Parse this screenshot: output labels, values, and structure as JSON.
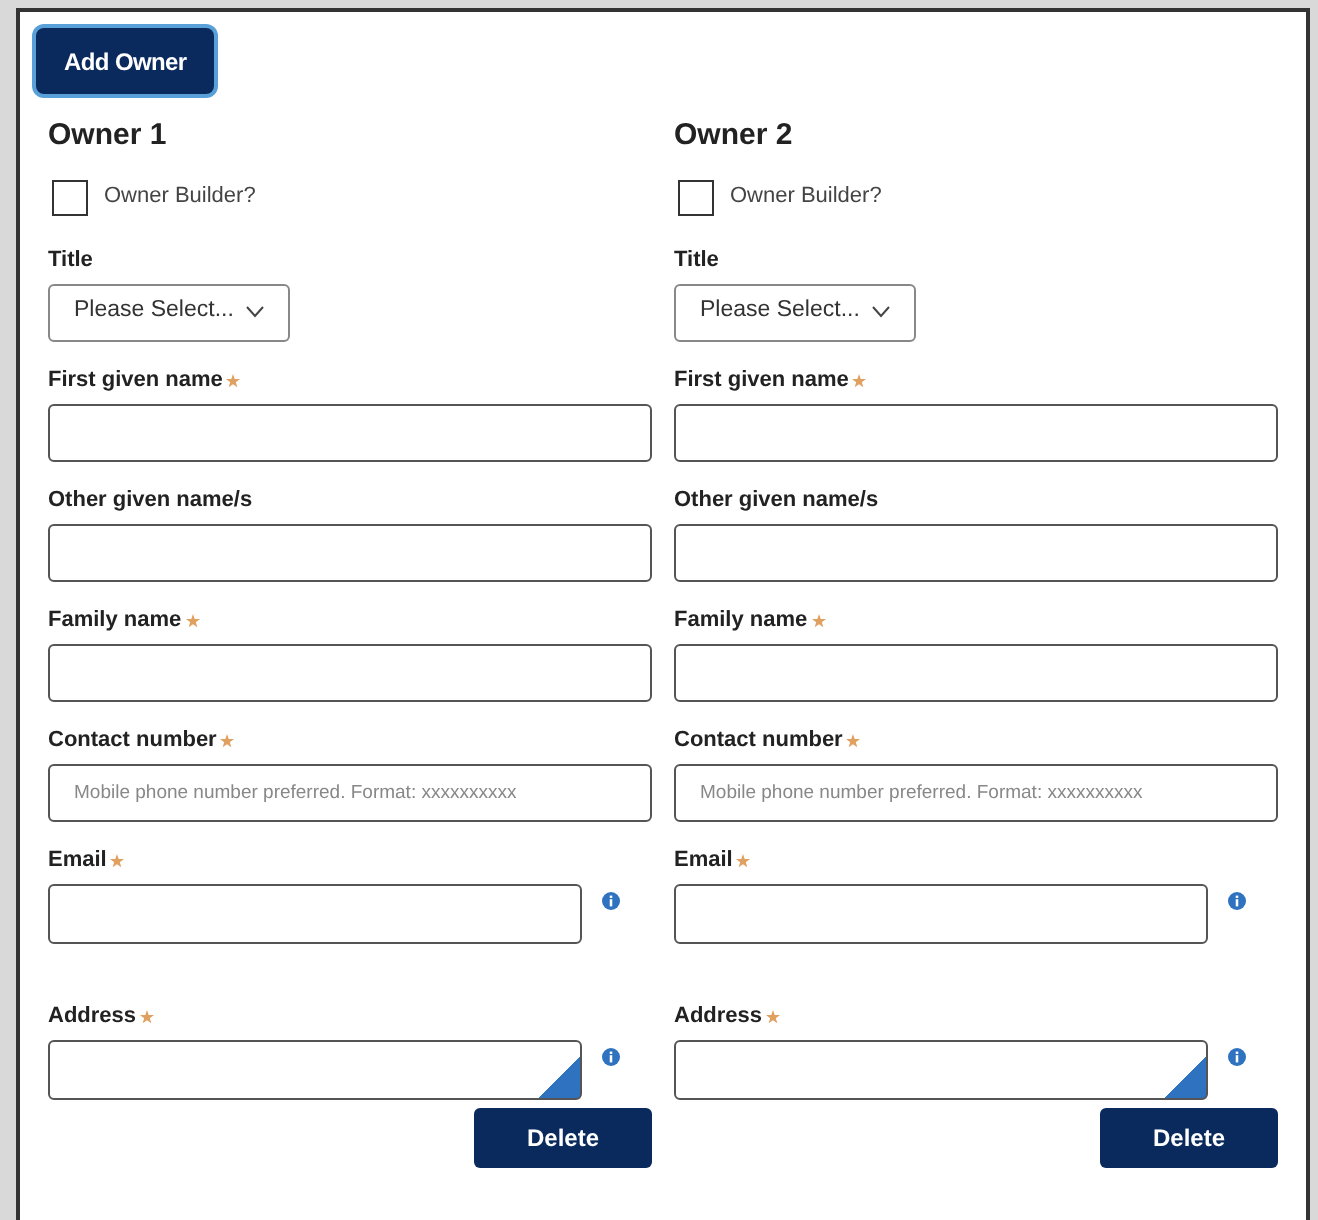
{
  "add_button": "Add Owner",
  "owners": [
    {
      "heading": "Owner 1",
      "owner_builder": {
        "label": "Owner Builder?",
        "checked": false
      },
      "fields": [
        {
          "kind": "select",
          "label": "Title",
          "required": false,
          "value": "Please Select..."
        },
        {
          "kind": "text",
          "label": "First given name",
          "required": true
        },
        {
          "kind": "text",
          "label": "Other given name/s",
          "required": false
        },
        {
          "kind": "text",
          "label": "Family name",
          "required": true
        },
        {
          "kind": "text",
          "label": "Contact number",
          "required": true,
          "placeholder": "Mobile phone number preferred. Format: xxxxxxxxxx"
        },
        {
          "kind": "info-text",
          "label": "Email",
          "required": true
        },
        {
          "kind": "info-textarea",
          "label": "Address",
          "required": true
        }
      ],
      "delete_button": "Delete"
    },
    {
      "heading": "Owner 2",
      "owner_builder": {
        "label": "Owner Builder?",
        "checked": false
      },
      "fields": [
        {
          "kind": "select",
          "label": "Title",
          "required": false,
          "value": "Please Select..."
        },
        {
          "kind": "text",
          "label": "First given name",
          "required": true
        },
        {
          "kind": "text",
          "label": "Other given name/s",
          "required": false
        },
        {
          "kind": "text",
          "label": "Family name",
          "required": true
        },
        {
          "kind": "text",
          "label": "Contact number",
          "required": true,
          "placeholder": "Mobile phone number preferred. Format: xxxxxxxxxx"
        },
        {
          "kind": "info-text",
          "label": "Email",
          "required": true
        },
        {
          "kind": "info-textarea",
          "label": "Address",
          "required": true
        }
      ],
      "delete_button": "Delete"
    }
  ]
}
